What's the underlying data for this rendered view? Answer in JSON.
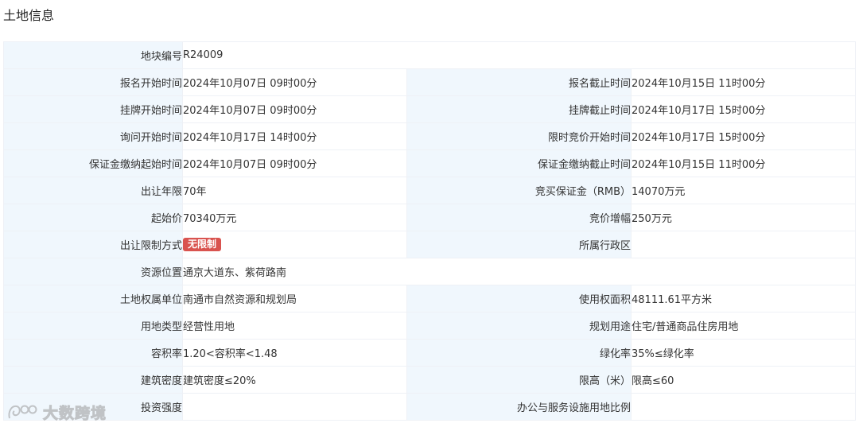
{
  "page": {
    "title": "土地信息"
  },
  "colors": {
    "label_bg": "#f0f7fd",
    "border": "#eef1f6",
    "badge_bg": "#d9534f"
  },
  "rows": {
    "parcel_no": {
      "label": "地块编号",
      "value": "R24009"
    },
    "reg_start": {
      "label": "报名开始时间",
      "value": "2024年10月07日 09时00分"
    },
    "reg_end": {
      "label": "报名截止时间",
      "value": "2024年10月15日 11时00分"
    },
    "list_start": {
      "label": "挂牌开始时间",
      "value": "2024年10月07日 09时00分"
    },
    "list_end": {
      "label": "挂牌截止时间",
      "value": "2024年10月17日 15时00分"
    },
    "inquiry_start": {
      "label": "询问开始时间",
      "value": "2024年10月17日 14时00分"
    },
    "timed_bid_start": {
      "label": "限时竞价开始时间",
      "value": "2024年10月17日 15时00分"
    },
    "deposit_start": {
      "label": "保证金缴纳起始时间",
      "value": "2024年10月07日 09时00分"
    },
    "deposit_end": {
      "label": "保证金缴纳截止时间",
      "value": "2024年10月15日 11时00分"
    },
    "term": {
      "label": "出让年限",
      "value": "70年"
    },
    "deposit": {
      "label": "竞买保证金（RMB）",
      "value": "14070万元"
    },
    "start_price": {
      "label": "起始价",
      "value": "70340万元"
    },
    "bid_step": {
      "label": "竞价增幅",
      "value": "250万元"
    },
    "restriction": {
      "label": "出让限制方式",
      "value": "无限制"
    },
    "district": {
      "label": "所属行政区",
      "value": ""
    },
    "location": {
      "label": "资源位置",
      "value": "通京大道东、紫荷路南"
    },
    "owner": {
      "label": "土地权属单位",
      "value": "南通市自然资源和规划局"
    },
    "area": {
      "label": "使用权面积",
      "value": "48111.61平方米"
    },
    "land_type": {
      "label": "用地类型",
      "value": "经营性用地"
    },
    "planned_use": {
      "label": "规划用途",
      "value": "住宅/普通商品住房用地"
    },
    "far": {
      "label": "容积率",
      "value": "1.20<容积率<1.48"
    },
    "green": {
      "label": "绿化率",
      "value": "35%≤绿化率"
    },
    "density": {
      "label": "建筑密度",
      "value": "建筑密度≤20%"
    },
    "height": {
      "label": "限高（米）",
      "value": "限高≤60"
    },
    "investment": {
      "label": "投资强度",
      "value": ""
    },
    "office_ratio": {
      "label": "办公与服务设施用地比例",
      "value": ""
    }
  },
  "watermark": {
    "text": "大数跨境",
    "icon": "brand-logo-icon"
  }
}
